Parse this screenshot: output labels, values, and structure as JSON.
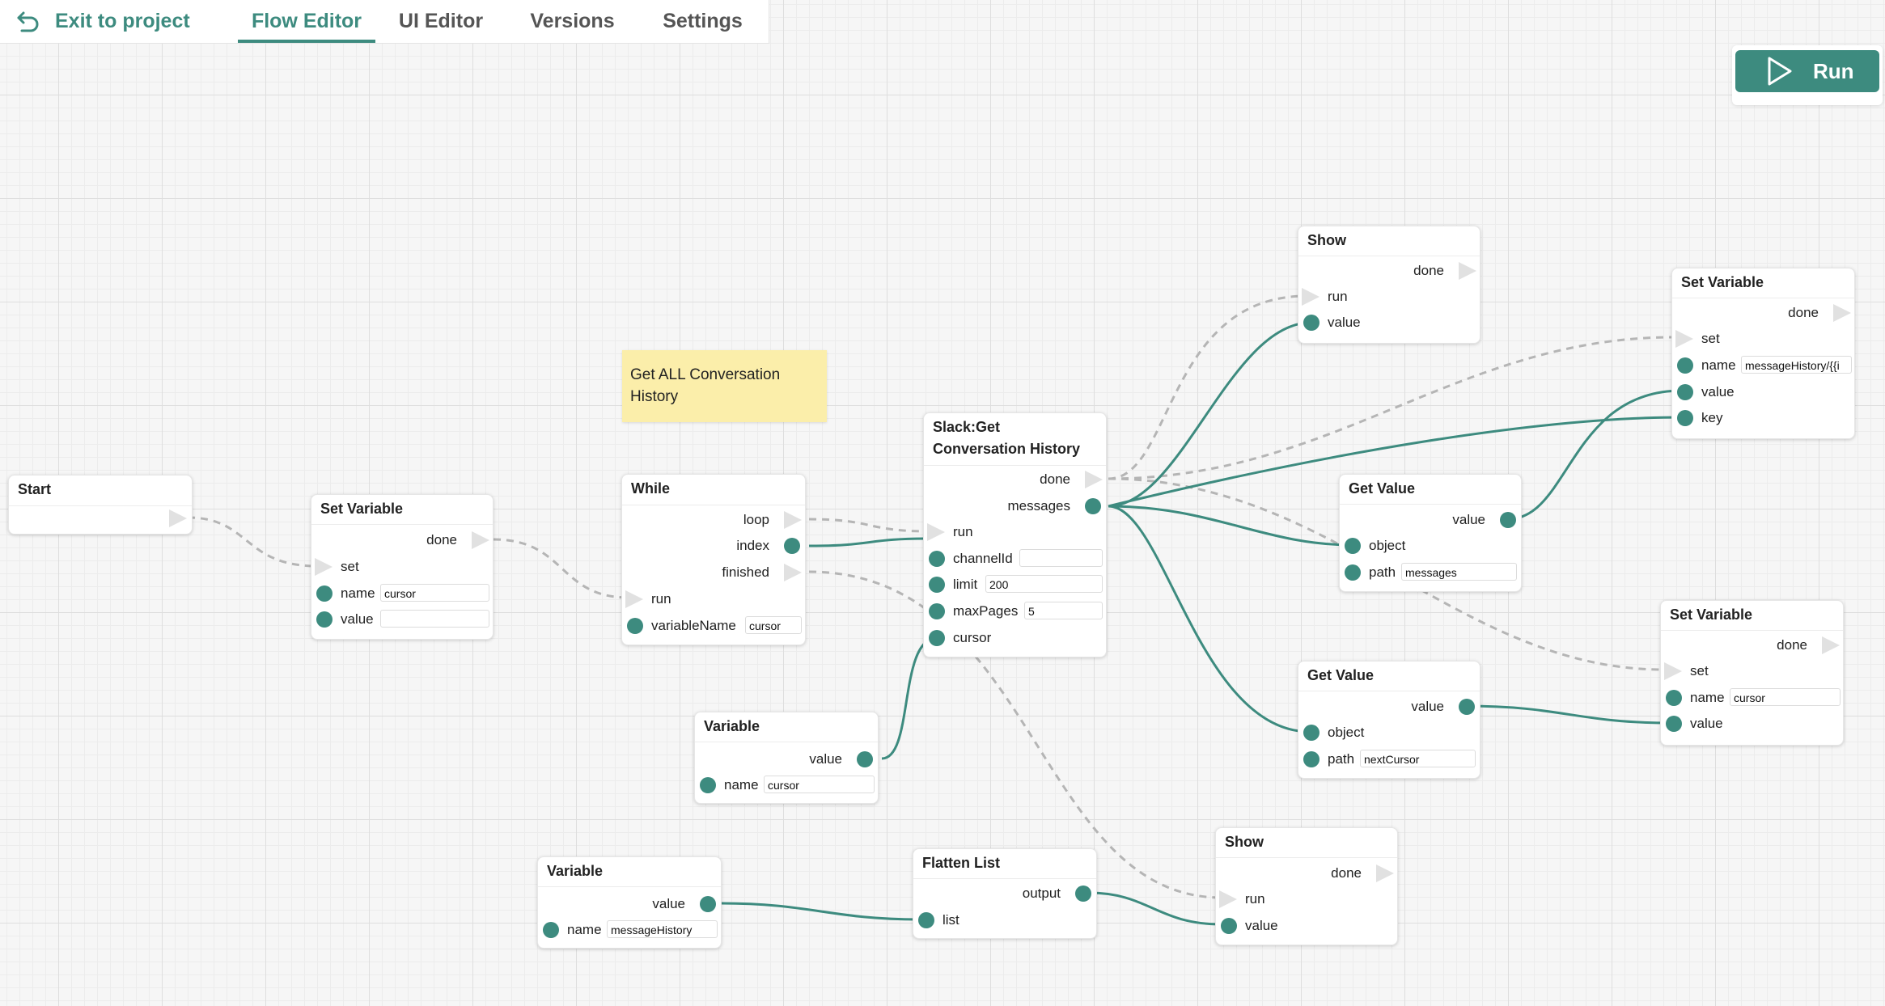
{
  "header": {
    "exit_label": "Exit to project",
    "tabs": [
      {
        "label": "Flow Editor",
        "active": true
      },
      {
        "label": "UI Editor",
        "active": false
      },
      {
        "label": "Versions",
        "active": false
      },
      {
        "label": "Settings",
        "active": false
      }
    ]
  },
  "run_label": "Run",
  "note": "Get ALL Conversation History",
  "nodes": {
    "start": {
      "title": "Start"
    },
    "setvar1": {
      "title": "Set Variable",
      "done": "done",
      "set": "set",
      "name": "name",
      "name_value": "cursor",
      "value": "value",
      "value_value": ""
    },
    "while": {
      "title": "While",
      "loop": "loop",
      "index": "index",
      "finished": "finished",
      "run": "run",
      "varname": "variableName",
      "varname_value": "cursor"
    },
    "slack": {
      "title_line1": "Slack:Get",
      "title_line2": "Conversation History",
      "done": "done",
      "messages": "messages",
      "run": "run",
      "channel": "channelId",
      "channel_value": "",
      "limit": "limit",
      "limit_value": "200",
      "maxpages": "maxPages",
      "maxpages_value": "5",
      "cursor": "cursor"
    },
    "var_cursor": {
      "title": "Variable",
      "value": "value",
      "name": "name",
      "name_value": "cursor"
    },
    "var_history": {
      "title": "Variable",
      "value": "value",
      "name": "name",
      "name_value": "messageHistory"
    },
    "flatten": {
      "title": "Flatten List",
      "output": "output",
      "list": "list"
    },
    "show_bottom": {
      "title": "Show",
      "done": "done",
      "run": "run",
      "value": "value"
    },
    "show_top": {
      "title": "Show",
      "done": "done",
      "run": "run",
      "value": "value"
    },
    "getvalue1": {
      "title": "Get Value",
      "value": "value",
      "object": "object",
      "path": "path",
      "path_value": "messages"
    },
    "getvalue2": {
      "title": "Get Value",
      "value": "value",
      "object": "object",
      "path": "path",
      "path_value": "nextCursor"
    },
    "setvar_top": {
      "title": "Set Variable",
      "done": "done",
      "set": "set",
      "name": "name",
      "name_value": "messageHistory/{{i",
      "value": "value",
      "key": "key"
    },
    "setvar_right": {
      "title": "Set Variable",
      "done": "done",
      "set": "set",
      "name": "name",
      "name_value": "cursor",
      "value": "value"
    }
  },
  "colors": {
    "accent": "#3d8b7f",
    "note": "#fbeeaa",
    "flow_wire": "#b9b9b9"
  }
}
